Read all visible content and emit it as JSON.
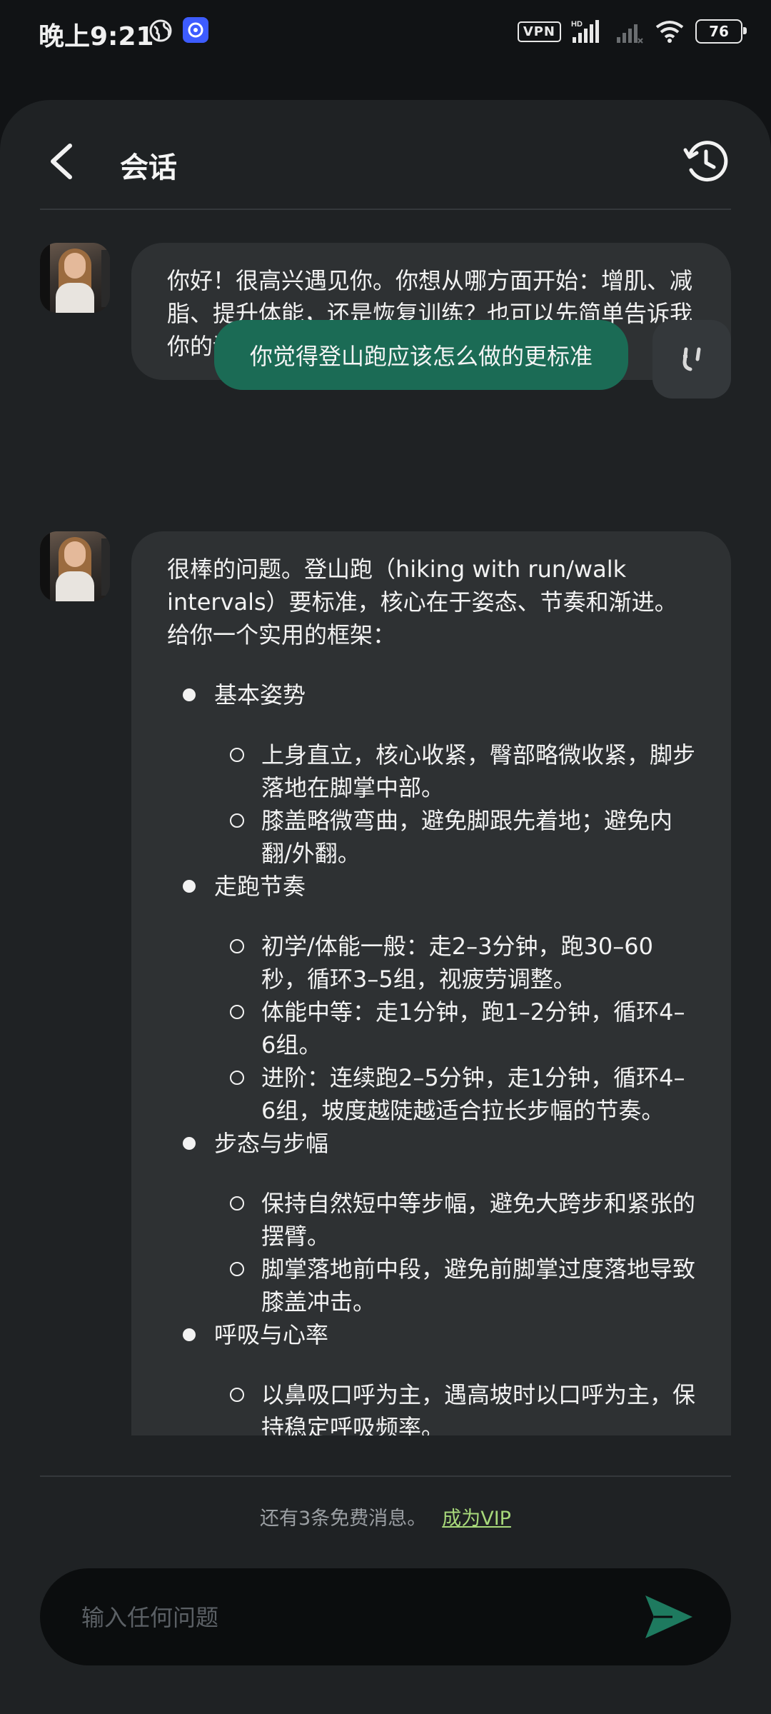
{
  "status_bar": {
    "time": "晚上9:21",
    "vpn": "VPN",
    "network": "HD",
    "battery": "76"
  },
  "header": {
    "title": "会话"
  },
  "messages": {
    "ai_greeting": "你好！很高兴遇见你。你想从哪方面开始：增肌、减脂、提升体能，还是恢复训练？也可以先简单告诉我你的训练现状和可用设备。",
    "user_question": "你觉得登山跑应该怎么做的更标准",
    "ai_answer": {
      "intro": "很棒的问题。登山跑（hiking with run/walk intervals）要标准，核心在于姿态、节奏和渐进。给你一个实用的框架：",
      "sections": [
        {
          "title": "基本姿势",
          "items": [
            "上身直立，核心收紧，臀部略微收紧，脚步落地在脚掌中部。",
            "膝盖略微弯曲，避免脚跟先着地；避免内翻/外翻。"
          ]
        },
        {
          "title": "走跑节奏",
          "items": [
            "初学/体能一般：走2–3分钟，跑30–60秒，循环3–5组，视疲劳调整。",
            "体能中等：走1分钟，跑1–2分钟，循环4–6组。",
            "进阶：连续跑2–5分钟，走1分钟，循环4–6组，坡度越陡越适合拉长步幅的节奏。"
          ]
        },
        {
          "title": "步态与步幅",
          "items": [
            "保持自然短中等步幅，避免大跨步和紧张的摆臂。",
            "脚掌落地前中段，避免前脚掌过度落地导致膝盖冲击。"
          ]
        },
        {
          "title": "呼吸与心率",
          "items": [
            "以鼻吸口呼为主，遇高坡时以口呼为主，保持稳定呼吸频率。"
          ]
        }
      ]
    }
  },
  "footer": {
    "free_messages": "还有3条免费消息。",
    "vip_link": "成为VIP"
  },
  "input": {
    "placeholder": "输入任何问题"
  },
  "colors": {
    "background": "#111315",
    "card": "#1f2224",
    "ai_bubble": "#2e3133",
    "user_bubble": "#1b6b55",
    "accent_send": "#1e7a5f",
    "vip_link": "#a7d87a"
  },
  "icons": {
    "back": "chevron-left-icon",
    "history": "history-clock-icon",
    "send": "send-arrow-icon",
    "user_avatar": "user-avatar-icon"
  }
}
